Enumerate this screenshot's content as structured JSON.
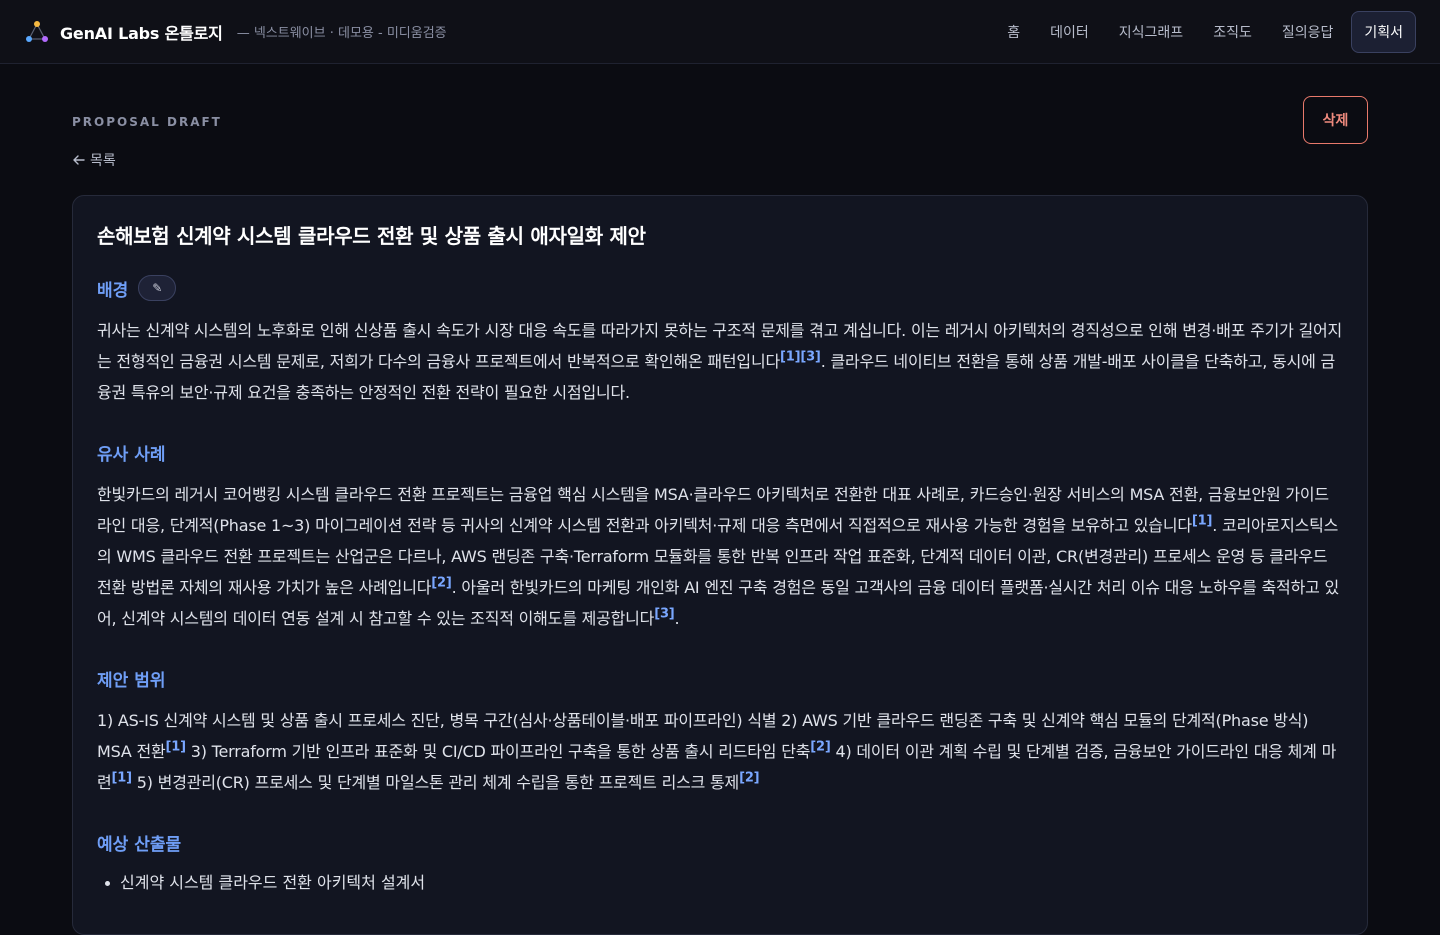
{
  "header": {
    "brand_name": "GenAI Labs 온톨로지",
    "brand_sub": "— 넥스트웨이브 · 데모용 - 미디움검증",
    "nav": [
      "홈",
      "데이터",
      "지식그래프",
      "조직도",
      "질의응답",
      "기획서"
    ],
    "active_nav": "기획서"
  },
  "page": {
    "eyebrow": "PROPOSAL DRAFT",
    "back_label": "목록",
    "delete_label": "삭제"
  },
  "doc": {
    "title": "손해보험 신계약 시스템 클라우드 전환 및 상품 출시 애자일화 제안",
    "edit_icon_glyph": "✎",
    "sections": {
      "background": {
        "title": "배경",
        "p1": "귀사는 신계약 시스템의 노후화로 인해 신상품 출시 속도가 시장 대응 속도를 따라가지 못하는 구조적 문제를 겪고 계십니다. 이는 레거시 아키텍처의 경직성으로 인해 변경·배포 주기가 길어지는 전형적인 금융권 시스템 문제로, 저희가 다수의 금융사 프로젝트에서 반복적으로 확인해온 패턴입니다",
        "c1": "[1]",
        "c2": "[3]",
        "p2": ". 클라우드 네이티브 전환을 통해 상품 개발-배포 사이클을 단축하고, 동시에 금융권 특유의 보안·규제 요건을 충족하는 안정적인 전환 전략이 필요한 시점입니다."
      },
      "cases": {
        "title": "유사 사례",
        "p1": "한빛카드의 레거시 코어뱅킹 시스템 클라우드 전환 프로젝트는 금융업 핵심 시스템을 MSA·클라우드 아키텍처로 전환한 대표 사례로, 카드승인·원장 서비스의 MSA 전환, 금융보안원 가이드라인 대응, 단계적(Phase 1~3) 마이그레이션 전략 등 귀사의 신계약 시스템 전환과 아키텍처·규제 대응 측면에서 직접적으로 재사용 가능한 경험을 보유하고 있습니다",
        "c1": "[1]",
        "p2": ". 코리아로지스틱스의 WMS 클라우드 전환 프로젝트는 산업군은 다르나, AWS 랜딩존 구축·Terraform 모듈화를 통한 반복 인프라 작업 표준화, 단계적 데이터 이관, CR(변경관리) 프로세스 운영 등 클라우드 전환 방법론 자체의 재사용 가치가 높은 사례입니다",
        "c2": "[2]",
        "p3": ". 아울러 한빛카드의 마케팅 개인화 AI 엔진 구축 경험은 동일 고객사의 금융 데이터 플랫폼·실시간 처리 이슈 대응 노하우를 축적하고 있어, 신계약 시스템의 데이터 연동 설계 시 참고할 수 있는 조직적 이해도를 제공합니다",
        "c3": "[3]",
        "p4": "."
      },
      "scope": {
        "title": "제안 범위",
        "p1": "1) AS-IS 신계약 시스템 및 상품 출시 프로세스 진단, 병목 구간(심사·상품테이블·배포 파이프라인) 식별 2) AWS 기반 클라우드 랜딩존 구축 및 신계약 핵심 모듈의 단계적(Phase 방식) MSA 전환",
        "c1": "[1]",
        "p2": " 3) Terraform 기반 인프라 표준화 및 CI/CD 파이프라인 구축을 통한 상품 출시 리드타임 단축",
        "c2": "[2]",
        "p3": " 4) 데이터 이관 계획 수립 및 단계별 검증, 금융보안 가이드라인 대응 체계 마련",
        "c3": "[1]",
        "p4": " 5) 변경관리(CR) 프로세스 및 단계별 마일스톤 관리 체계 수립을 통한 프로젝트 리스크 통제",
        "c4": "[2]"
      },
      "deliverables": {
        "title": "예상 산출물",
        "items": [
          "신계약 시스템 클라우드 전환 아키텍처 설계서"
        ]
      }
    }
  }
}
